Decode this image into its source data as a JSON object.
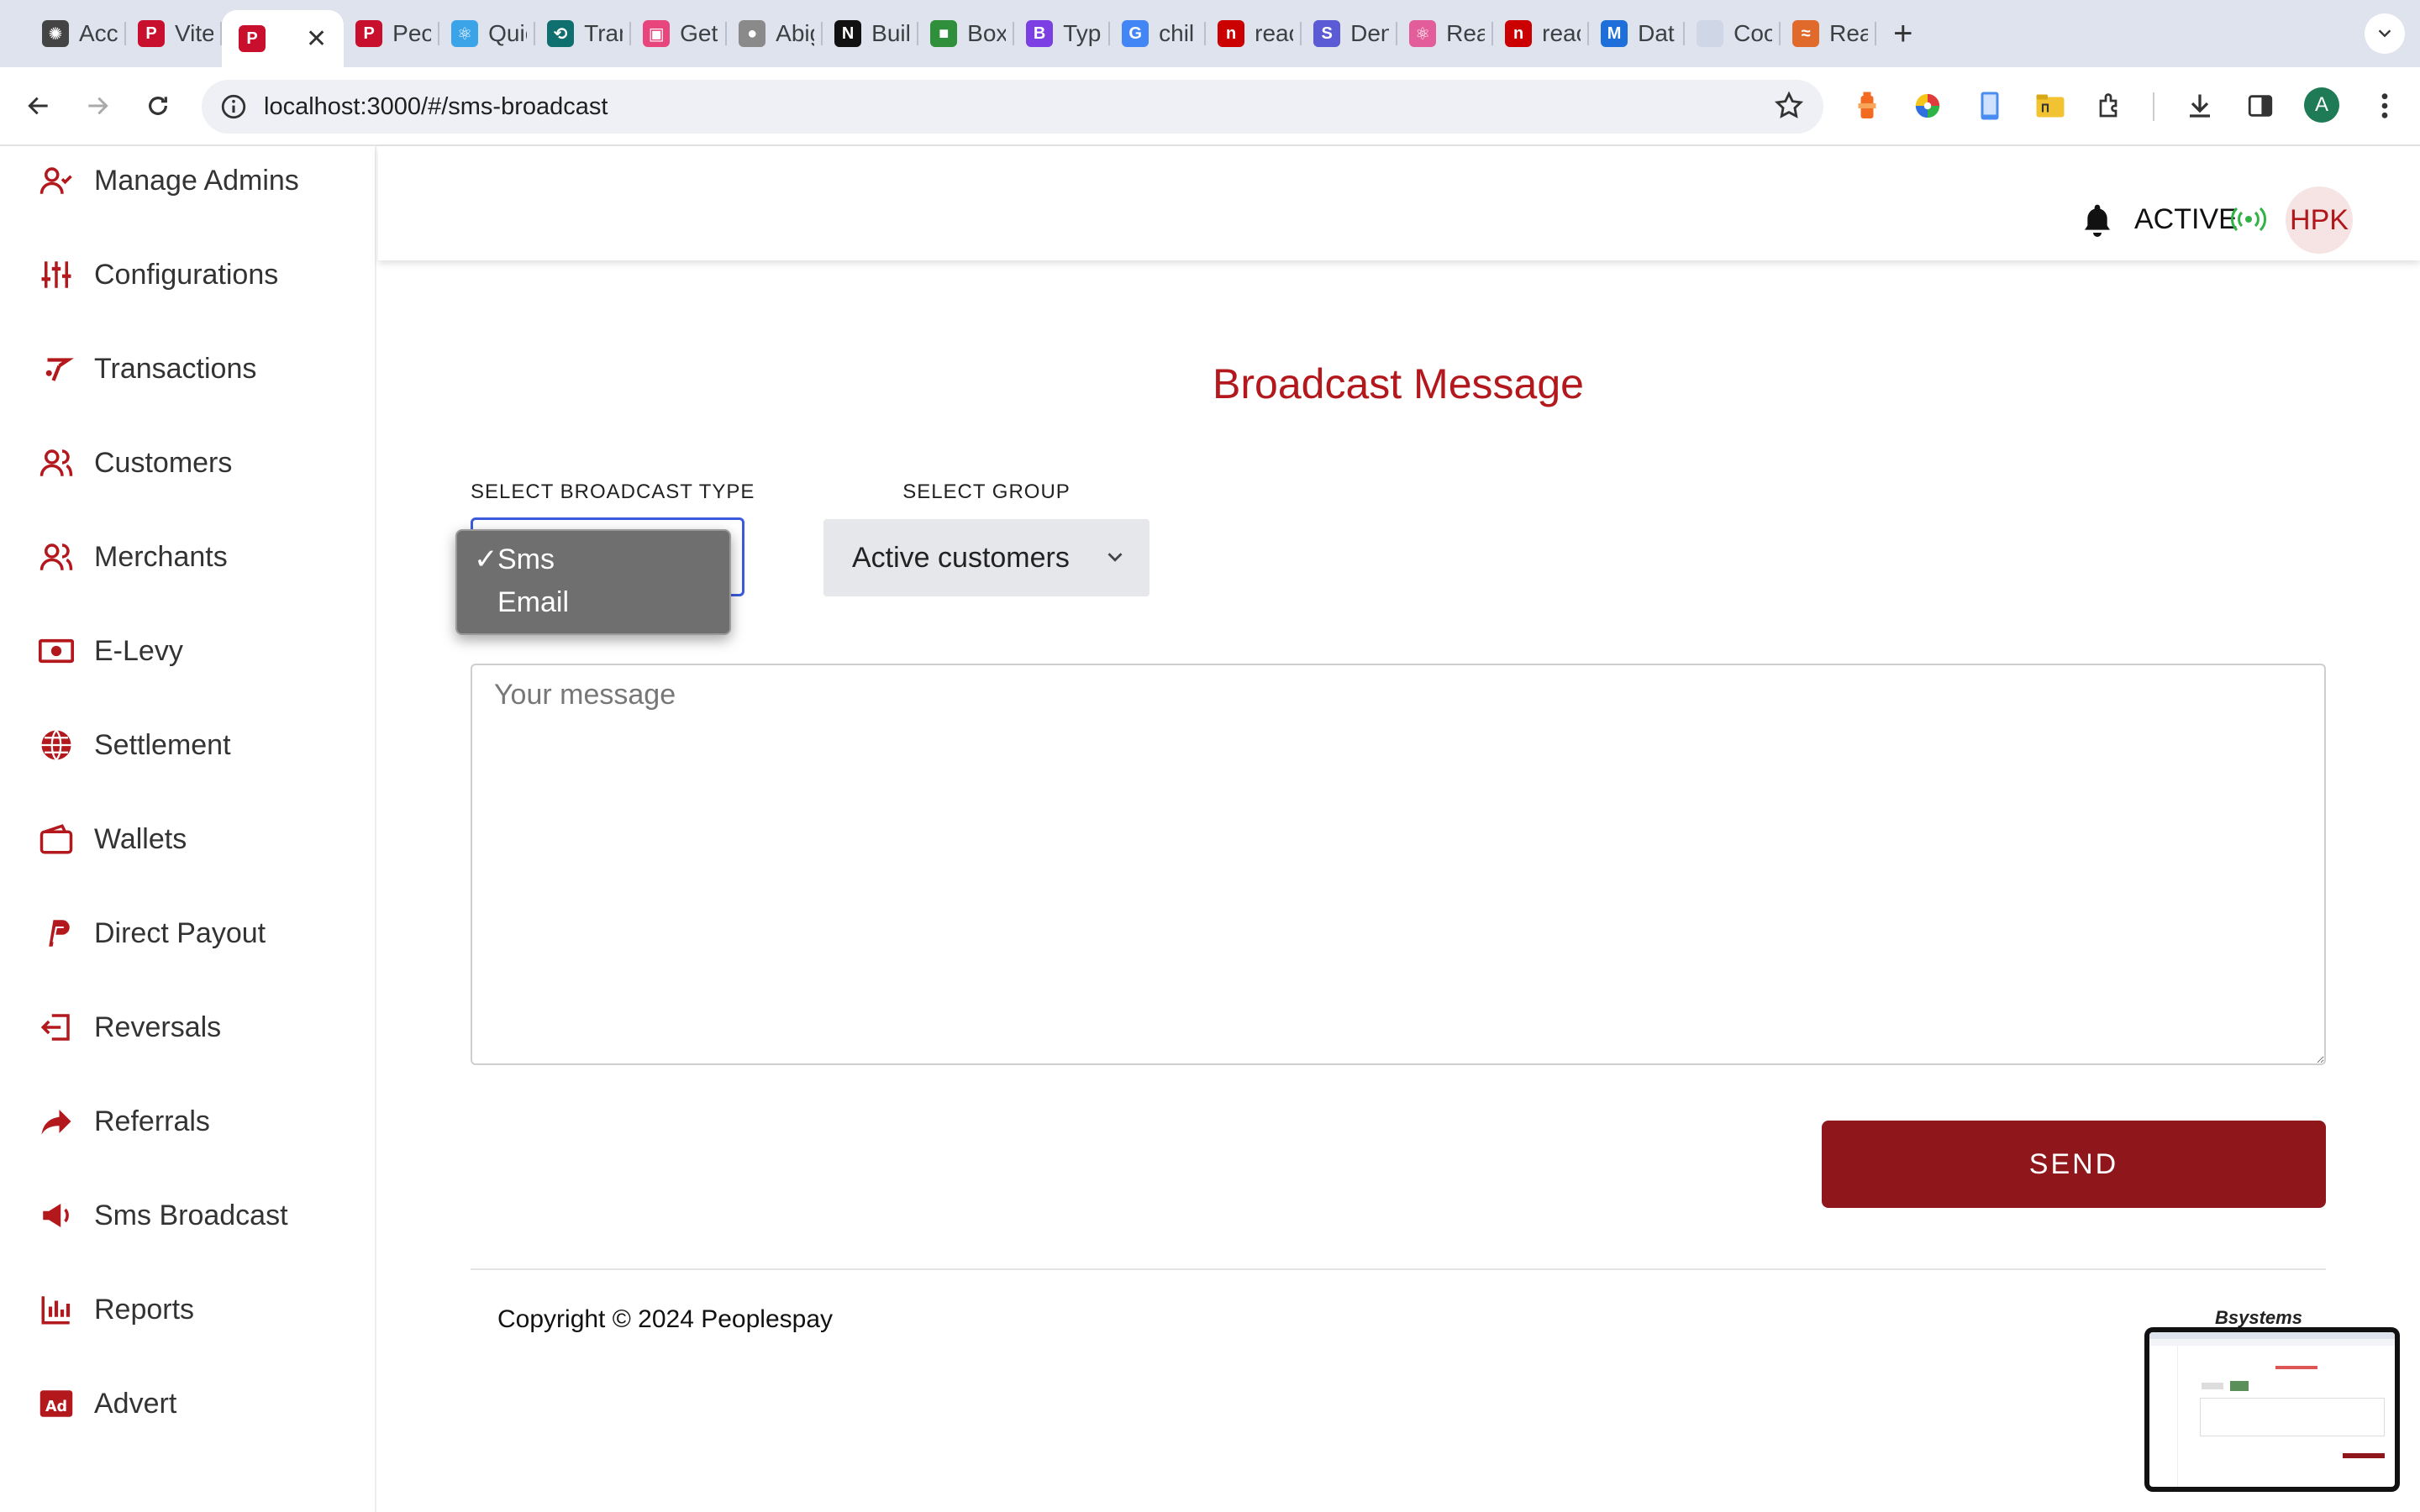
{
  "browser": {
    "tabs": [
      {
        "title": "Acc",
        "icon": "openai-icon",
        "color": "#444444"
      },
      {
        "title": "Vite",
        "icon": "peoplespay-icon",
        "color": "#c8102e"
      },
      {
        "title": "",
        "icon": "peoplespay-icon",
        "color": "#c8102e",
        "active": true
      },
      {
        "title": "Peo",
        "icon": "peoplespay-icon",
        "color": "#c8102e"
      },
      {
        "title": "Quic",
        "icon": "react-icon",
        "color": "#3ba4e8"
      },
      {
        "title": "Tran",
        "icon": "transform-icon",
        "color": "#0f6e6e"
      },
      {
        "title": "Get",
        "icon": "get-icon",
        "color": "#e8457d"
      },
      {
        "title": "Abig",
        "icon": "github-icon",
        "color": "#8a8a8a"
      },
      {
        "title": "Buil",
        "icon": "nextjs-icon",
        "color": "#111111"
      },
      {
        "title": "Box",
        "icon": "box-icon",
        "color": "#2f8f3a"
      },
      {
        "title": "Typ",
        "icon": "bootstrap-icon",
        "color": "#7b3fe4"
      },
      {
        "title": "chil",
        "icon": "google-icon",
        "color": "#4285f4"
      },
      {
        "title": "reac",
        "icon": "npm-icon",
        "color": "#cb0000"
      },
      {
        "title": "Den",
        "icon": "stripe-icon",
        "color": "#5b5bd6"
      },
      {
        "title": "Rea",
        "icon": "react-icon",
        "color": "#e35d9b"
      },
      {
        "title": "reac",
        "icon": "npm-icon",
        "color": "#cb0000"
      },
      {
        "title": "Dat",
        "icon": "mui-icon",
        "color": "#1e6fd9"
      },
      {
        "title": "Coo",
        "icon": "blank-page-icon",
        "color": "#cfd6e6"
      },
      {
        "title": "Rea",
        "icon": "tailwind-icon",
        "color": "#e06a2c"
      }
    ],
    "close_glyph": "✕",
    "new_tab_glyph": "+",
    "url": "localhost:3000/#/sms-broadcast",
    "profile_initial": "A"
  },
  "sidebar": {
    "items": [
      {
        "label": "Manage Admins",
        "icon": "user-check-icon"
      },
      {
        "label": "Configurations",
        "icon": "sliders-icon"
      },
      {
        "label": "Transactions",
        "icon": "transactions-icon"
      },
      {
        "label": "Customers",
        "icon": "users-icon"
      },
      {
        "label": "Merchants",
        "icon": "users-icon"
      },
      {
        "label": "E-Levy",
        "icon": "cash-icon"
      },
      {
        "label": "Settlement",
        "icon": "globe-icon"
      },
      {
        "label": "Wallets",
        "icon": "wallet-icon"
      },
      {
        "label": "Direct Payout",
        "icon": "paypal-icon"
      },
      {
        "label": "Reversals",
        "icon": "reverse-icon"
      },
      {
        "label": "Referrals",
        "icon": "share-icon"
      },
      {
        "label": "Sms Broadcast",
        "icon": "megaphone-icon"
      },
      {
        "label": "Reports",
        "icon": "bar-chart-icon"
      },
      {
        "label": "Advert",
        "icon": "ad-icon"
      }
    ]
  },
  "header": {
    "status": "ACTIVE",
    "avatar_initials": "HPK"
  },
  "main": {
    "title": "Broadcast Message",
    "broadcast_type_label": "SELECT BROADCAST TYPE",
    "broadcast_type_options": [
      "Sms",
      "Email"
    ],
    "broadcast_type_selected": "Sms",
    "check_glyph": "✓",
    "group_label": "SELECT GROUP",
    "group_value": "Active customers",
    "message_placeholder": "Your message",
    "send_label": "SEND"
  },
  "footer": {
    "copyright": "Copyright © 2024 Peoplespay",
    "brand": "Bsystems"
  },
  "colors": {
    "brand_red": "#b3181d",
    "button_red": "#8f171c",
    "active_green": "#2fb344"
  }
}
